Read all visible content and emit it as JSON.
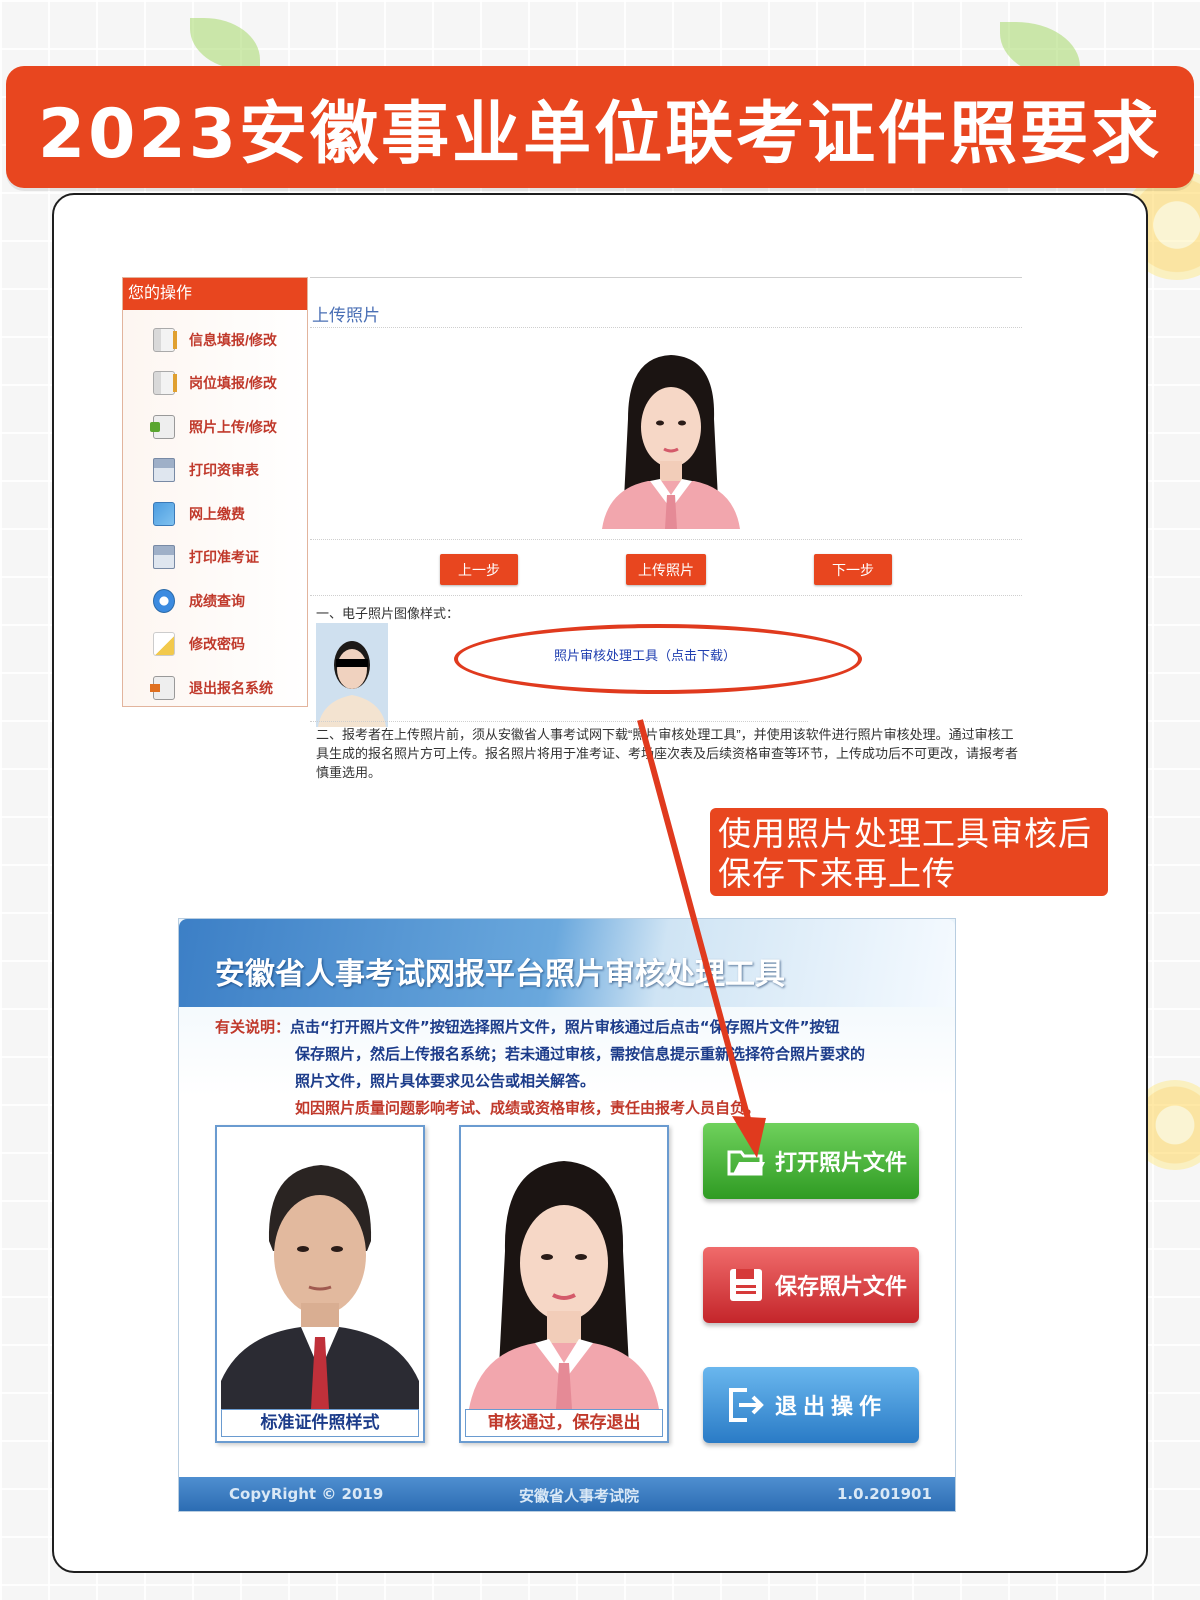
{
  "banner": {
    "title": "2023安徽事业单位联考证件照要求"
  },
  "web": {
    "sidebar": {
      "header": "您的操作",
      "items": [
        {
          "label": "信息填报/修改",
          "icon": "document-icon"
        },
        {
          "label": "岗位填报/修改",
          "icon": "document-icon"
        },
        {
          "label": "照片上传/修改",
          "icon": "photo-upload-icon"
        },
        {
          "label": "打印资审表",
          "icon": "printer-icon"
        },
        {
          "label": "网上缴费",
          "icon": "payment-card-icon"
        },
        {
          "label": "打印准考证",
          "icon": "printer-icon"
        },
        {
          "label": "成绩查询",
          "icon": "search-icon"
        },
        {
          "label": "修改密码",
          "icon": "pencil-icon"
        },
        {
          "label": "退出报名系统",
          "icon": "exit-icon"
        }
      ]
    },
    "upload_title": "上传照片",
    "buttons": {
      "prev": "上一步",
      "upload": "上传照片",
      "next": "下一步"
    },
    "section1": "一、电子照片图像样式：",
    "tool_link": "照片审核处理工具（点击下载）",
    "section2": "二、报考者在上传照片前，须从安徽省人事考试网下载“照片审核处理工具”，并使用该软件进行照片审核处理。通过审核工具生成的报名照片方可上传。报名照片将用于准考证、考场座次表及后续资格审查等环节，上传成功后不可更改，请报考者慎重选用。"
  },
  "callout": {
    "line1": "使用照片处理工具审核后",
    "line2": "保存下来再上传"
  },
  "tool": {
    "title": "安徽省人事考试网报平台照片审核处理工具",
    "note_label": "有关说明：",
    "note_line1": "点击“打开照片文件”按钮选择照片文件，照片审核通过后点击“保存照片文件”按钮",
    "note_line2": "保存照片，然后上传报名系统；若未通过审核，需按信息提示重新选择符合照片要求的",
    "note_line3": "照片文件，照片具体要求见公告或相关解答。",
    "note_warning": "如因照片质量问题影响考试、成绩或资格审核，责任由报考人员自负。",
    "sample_caption": "标准证件照样式",
    "result_caption": "审核通过，保存退出",
    "open_button": "打开照片文件",
    "save_button": "保存照片文件",
    "exit_button": "退出操作",
    "footer_copyright": "CopyRight © 2019",
    "footer_org": "安徽省人事考试院",
    "footer_version": "1.0.201901"
  },
  "colors": {
    "brand_orange": "#e8461f",
    "tool_blue": "#2c6db3",
    "link_blue": "#1f3eb0"
  }
}
